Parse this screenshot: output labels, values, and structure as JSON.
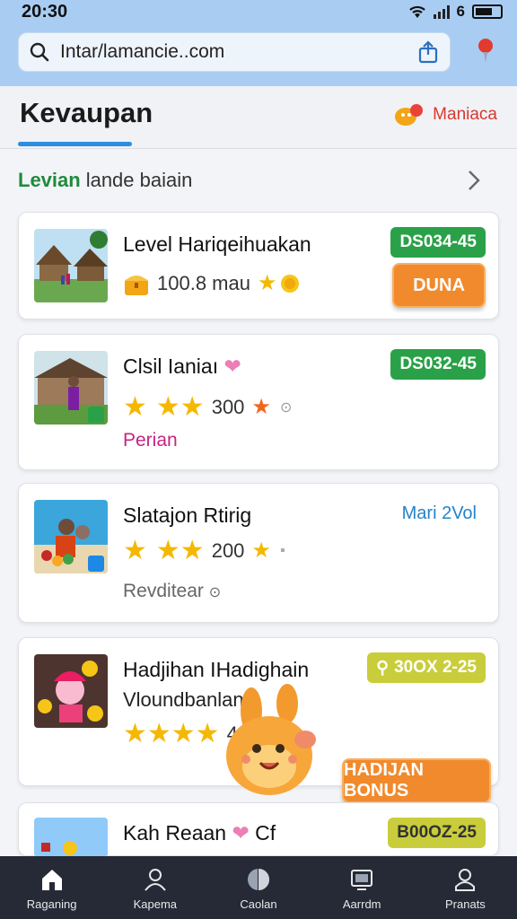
{
  "status_bar": {
    "time": "20:30",
    "battery": "6"
  },
  "browser": {
    "url": "Intar/lamancie..com"
  },
  "header": {
    "title": "Kevaupan",
    "brand_label": "Maniaca"
  },
  "section": {
    "title_highlight": "Levian",
    "title_rest": "lande baiain"
  },
  "cards": [
    {
      "title": "Level Hariqeihuakan",
      "rating_value": "100.8 mau",
      "tag": "DS034-45",
      "button": "DUNA"
    },
    {
      "title": "Clsil Ianiaı",
      "rating_value": "300",
      "tag": "DS032-45",
      "status": "Perian"
    },
    {
      "title": "Slatajon Rtirig",
      "rating_value": "200",
      "tag": "Mari 2Vol",
      "status": "Revditear"
    },
    {
      "title": "Hadjihan IHadighain",
      "subtitle": "Vloundbanlan",
      "rating_value": "40",
      "tag": "30OX 2-25",
      "button": "HADIJAN BONUS"
    },
    {
      "title": "Kah Reaan",
      "title_suffix": "Cf",
      "tag": "B00OZ-25"
    }
  ],
  "nav": [
    {
      "label": "Raganing",
      "icon": "home-icon"
    },
    {
      "label": "Kapema",
      "icon": "people-icon"
    },
    {
      "label": "Caolan",
      "icon": "globe-icon"
    },
    {
      "label": "Aarrdm",
      "icon": "tv-icon"
    },
    {
      "label": "Pranats",
      "icon": "profile-icon"
    }
  ],
  "colors": {
    "accent": "#2d8de0",
    "tag_green": "#2aa148",
    "button_orange": "#f18a2c",
    "nav_bg": "#252a36"
  }
}
